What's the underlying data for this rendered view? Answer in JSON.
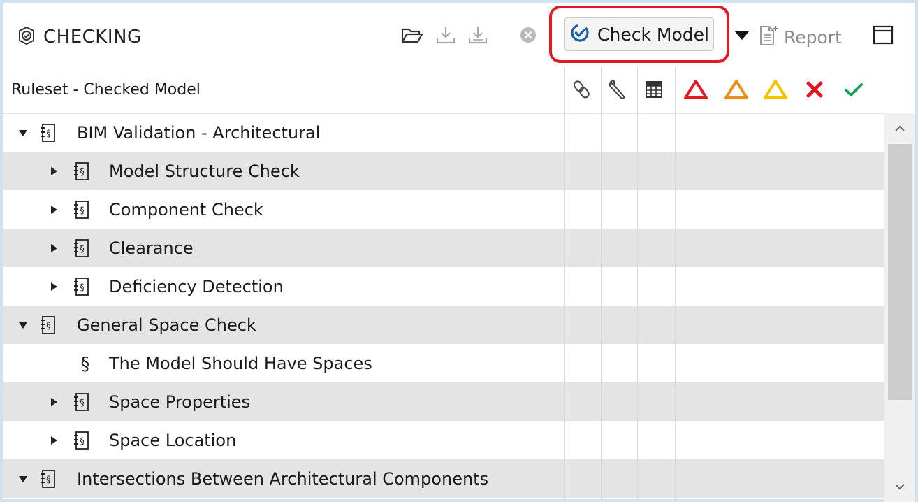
{
  "colors": {
    "accent_blue": "#1f5fa8",
    "highlight_red": "#e01b24",
    "critical_red": "#e01b24",
    "moderate_orange": "#f08c1e",
    "low_yellow": "#f2c400",
    "reject_red": "#e81123",
    "accept_green": "#17a058",
    "row_alt": "#e4e4e4"
  },
  "toolbar": {
    "title": "CHECKING",
    "check_model_label": "Check Model",
    "report_label": "Report",
    "icons": [
      "checking-icon",
      "open-folder-icon",
      "import-icon",
      "import-disabled-icon",
      "cancel-icon",
      "check-model-icon",
      "dropdown-arrow-icon",
      "report-icon",
      "window-icon"
    ]
  },
  "header": {
    "title": "Ruleset - Checked Model",
    "column_icons": [
      "link-icon",
      "wrench-icon",
      "table-icon",
      "critical-warning-icon",
      "moderate-warning-icon",
      "low-warning-icon",
      "reject-icon",
      "accept-icon"
    ]
  },
  "tree": {
    "rows": [
      {
        "label": "BIM Validation - Architectural",
        "level": 0,
        "toggle": "expanded",
        "icon": "ruleset-icon"
      },
      {
        "label": "Model Structure Check",
        "level": 1,
        "toggle": "collapsed",
        "icon": "ruleset-icon"
      },
      {
        "label": "Component Check",
        "level": 1,
        "toggle": "collapsed",
        "icon": "ruleset-icon"
      },
      {
        "label": "Clearance",
        "level": 1,
        "toggle": "collapsed",
        "icon": "ruleset-icon"
      },
      {
        "label": "Deficiency Detection",
        "level": 1,
        "toggle": "collapsed",
        "icon": "ruleset-icon"
      },
      {
        "label": "General Space Check",
        "level": 0,
        "toggle": "expanded",
        "icon": "ruleset-icon"
      },
      {
        "label": "The Model Should Have Spaces",
        "level": 1,
        "toggle": "none",
        "icon": "rule-icon"
      },
      {
        "label": "Space Properties",
        "level": 1,
        "toggle": "collapsed",
        "icon": "ruleset-icon"
      },
      {
        "label": "Space Location",
        "level": 1,
        "toggle": "collapsed",
        "icon": "ruleset-icon"
      },
      {
        "label": "Intersections Between Architectural Components",
        "level": 0,
        "toggle": "expanded",
        "icon": "ruleset-icon"
      }
    ]
  }
}
